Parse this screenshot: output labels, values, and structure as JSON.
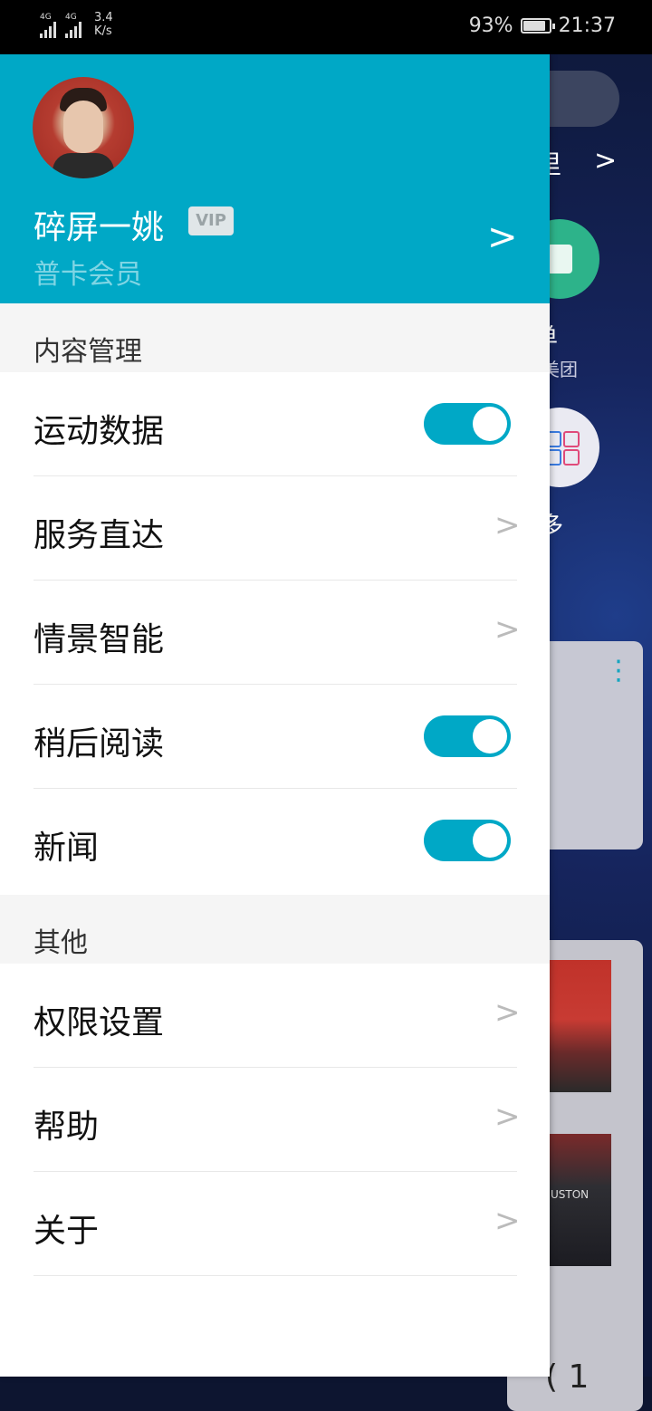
{
  "status_bar": {
    "signal1": "4G",
    "signal2": "4G",
    "net_speed_value": "3.4",
    "net_speed_unit": "K/s",
    "battery_percent": "93%",
    "battery_level": 0.93,
    "time": "21:37"
  },
  "profile": {
    "username": "碎屏一姚",
    "vip_badge": "VIP",
    "member_level": "普卡会员"
  },
  "sections": {
    "content": {
      "title": "内容管理",
      "items": [
        {
          "label": "运动数据",
          "control": "toggle",
          "on": true
        },
        {
          "label": "服务直达",
          "control": "chevron"
        },
        {
          "label": "情景智能",
          "control": "chevron"
        },
        {
          "label": "稍后阅读",
          "control": "toggle",
          "on": true
        },
        {
          "label": "新闻",
          "control": "toggle",
          "on": true
        }
      ]
    },
    "other": {
      "title": "其他",
      "items": [
        {
          "label": "权限设置",
          "control": "chevron"
        },
        {
          "label": "帮助",
          "control": "chevron"
        },
        {
          "label": "关于",
          "control": "chevron"
        }
      ]
    }
  },
  "background": {
    "row_text": "里",
    "service_label": "单",
    "service_sub": "美团",
    "more_label": "多",
    "image_caption": "USTON",
    "bottom_text": "( 1"
  },
  "colors": {
    "accent": "#00a8c6",
    "section_bg": "#f5f5f5"
  }
}
